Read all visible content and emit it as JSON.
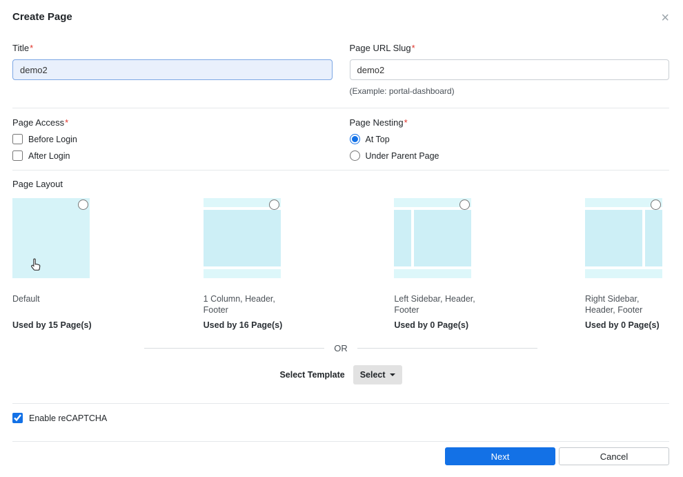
{
  "modal": {
    "title": "Create Page",
    "close_icon": "×"
  },
  "fields": {
    "title": {
      "label": "Title",
      "required": "*",
      "value": "demo2"
    },
    "slug": {
      "label": "Page URL Slug",
      "required": "*",
      "value": "demo2",
      "hint": "(Example: portal-dashboard)"
    }
  },
  "page_access": {
    "label": "Page Access",
    "required": "*",
    "options": [
      {
        "label": "Before Login",
        "checked": false
      },
      {
        "label": "After Login",
        "checked": false
      }
    ]
  },
  "page_nesting": {
    "label": "Page Nesting",
    "required": "*",
    "options": [
      {
        "label": "At Top",
        "selected": true
      },
      {
        "label": "Under Parent Page",
        "selected": false
      }
    ]
  },
  "page_layout": {
    "label": "Page Layout",
    "options": [
      {
        "name": "Default",
        "usage": "Used by 15 Page(s)",
        "selected": false
      },
      {
        "name": "1 Column, Header, Footer",
        "usage": "Used by 16 Page(s)",
        "selected": false
      },
      {
        "name": "Left Sidebar, Header, Footer",
        "usage": "Used by 0 Page(s)",
        "selected": false
      },
      {
        "name": "Right Sidebar, Header, Footer",
        "usage": "Used by 0 Page(s)",
        "selected": false
      }
    ],
    "or_text": "OR",
    "select_template_label": "Select Template",
    "select_button_label": "Select"
  },
  "recaptcha": {
    "label": "Enable reCAPTCHA",
    "checked": true
  },
  "footer": {
    "next_label": "Next",
    "cancel_label": "Cancel"
  },
  "colors": {
    "primary": "#1371e6",
    "thumbnail_main": "#cdeff6",
    "thumbnail_bar": "#ddf7fa",
    "required": "#e0342b"
  }
}
